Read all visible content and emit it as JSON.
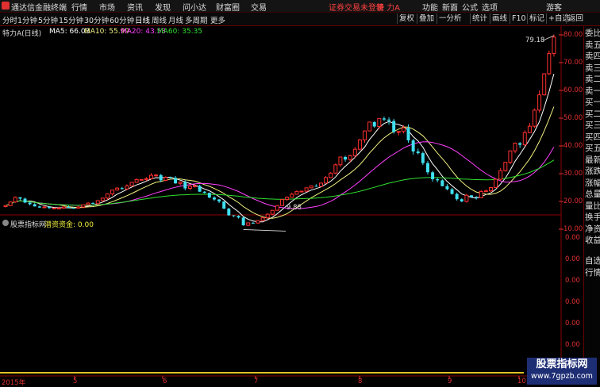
{
  "app": {
    "title": "通达信金融终端"
  },
  "menu": [
    "行情",
    "市场",
    "资讯",
    "发现",
    "问小达",
    "财富圈",
    "交易"
  ],
  "notice": "证券交易未登录",
  "stock_title": "特 力A",
  "right_menu": [
    "功能",
    "新面",
    "公式",
    "选项"
  ],
  "user": "游客",
  "periods": [
    "分时",
    "1分钟",
    "5分钟",
    "15分钟",
    "30分钟",
    "60分钟",
    "日线",
    "周线",
    "月线",
    "多周期",
    "更多"
  ],
  "active_period": "日线",
  "toolbar_right": [
    "复权",
    "叠加",
    "一分析",
    "统计",
    "画线",
    "F10",
    "标记",
    "+自选",
    "返回"
  ],
  "chart_header": {
    "name": "特力A(日线)",
    "ma5": "MA5: 66.03",
    "ma10": "MA10: 55.99",
    "ma20": "MA20: 43.53",
    "ma60": "MA60: 35.35"
  },
  "indicator_header": {
    "name": "股票指标网",
    "label": "潜资资金: 0.00"
  },
  "y_axis_main": [
    "80.00",
    "70.00",
    "60.00",
    "50.00",
    "40.00",
    "30.00",
    "20.00",
    "10.00"
  ],
  "y_axis_sub": [
    "0.00",
    "0.00",
    "0.00",
    "0.00",
    "0.00",
    "0.00"
  ],
  "annotations": {
    "high": "79.18",
    "low": "9.88"
  },
  "x_axis": [
    "2015年",
    "5",
    "6",
    "7",
    "8",
    "9",
    "10"
  ],
  "right_panel": [
    "委比",
    "卖五",
    "卖四",
    "卖三",
    "卖二",
    "卖一",
    "买一",
    "买二",
    "买三",
    "买四",
    "买五",
    "最新",
    "涨跌",
    "涨幅",
    "总量",
    "量比",
    "换手",
    "净资",
    "收益",
    "",
    "自选",
    "行情"
  ],
  "watermark": {
    "line1": "股票指标网",
    "line2": "www.7gpzb.com"
  },
  "colors": {
    "up": "#ff3030",
    "down": "#40e0f0",
    "ma5": "#ffffff",
    "ma10": "#f0f080",
    "ma20": "#ff40ff",
    "ma60": "#30e030",
    "axis": "#e03030"
  },
  "chart_data": {
    "type": "candlestick",
    "title": "特力A(日线)",
    "ylim": [
      8,
      84
    ],
    "x": [
      "2015年",
      "5",
      "6",
      "7",
      "8",
      "9",
      "10"
    ],
    "closes": [
      18.5,
      19.8,
      21.5,
      21.0,
      19.6,
      19.0,
      18.2,
      17.8,
      18.0,
      17.6,
      17.6,
      17.6,
      18.0,
      17.7,
      17.6,
      18.0,
      18.8,
      19.4,
      19.2,
      20.3,
      21.2,
      22.7,
      24.1,
      24.8,
      24.5,
      25.6,
      26.9,
      27.9,
      27.9,
      28.2,
      29.4,
      29.5,
      27.6,
      28.7,
      28.5,
      26.5,
      27.0,
      24.7,
      25.5,
      25.6,
      23.5,
      23.1,
      21.4,
      20.7,
      20.0,
      17.4,
      15.0,
      14.8,
      14.2,
      11.4,
      12.3,
      12.2,
      13.1,
      14.1,
      15.4,
      16.8,
      18.5,
      20.7,
      21.5,
      22.6,
      23.6,
      23.7,
      24.9,
      25.6,
      25.4,
      26.6,
      28.6,
      30.2,
      33.2,
      36.0,
      35.1,
      36.5,
      38.8,
      42.2,
      45.4,
      48.6,
      47.0,
      49.9,
      49.5,
      49.0,
      45.0,
      45.2,
      46.5,
      42.0,
      38.0,
      37.4,
      33.8,
      30.5,
      28.0,
      27.6,
      25.5,
      24.4,
      22.7,
      20.8,
      20.0,
      22.2,
      21.6,
      21.3,
      23.6,
      23.8,
      25.0,
      28.0,
      31.1,
      34.1,
      38.2,
      41.0,
      40.4,
      44.8,
      47.1,
      52.9,
      58.4,
      66.0,
      73.3,
      79.2
    ],
    "ma_values": {
      "MA5": 66.03,
      "MA10": 55.99,
      "MA20": 43.53,
      "MA60": 35.35
    },
    "high_label": 79.18,
    "low_label": 9.88
  }
}
